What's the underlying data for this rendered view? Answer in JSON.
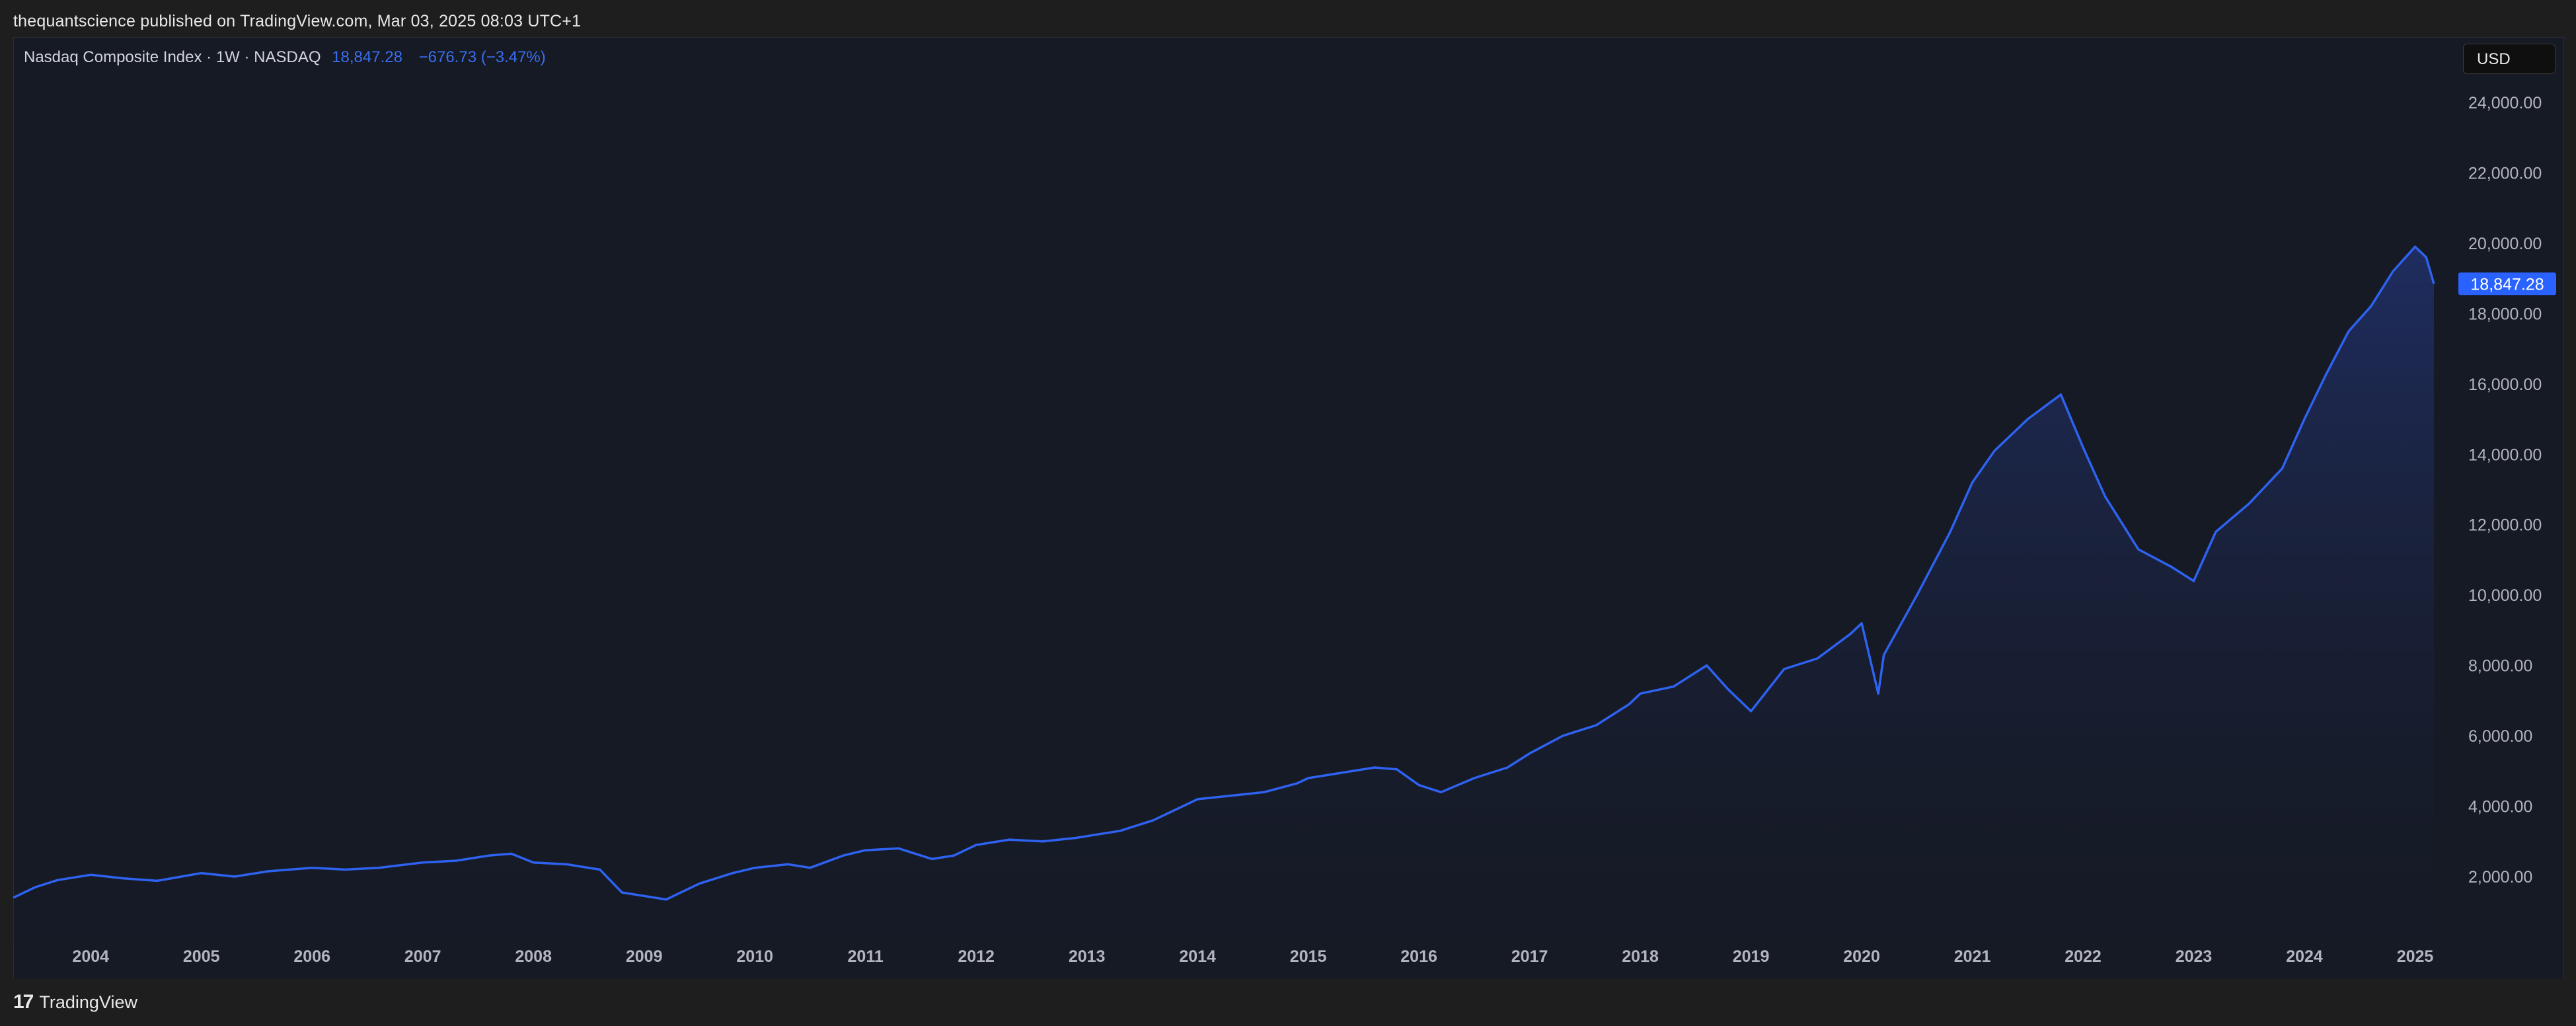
{
  "header": {
    "publish_line": "thequantscience published on TradingView.com, Mar 03, 2025 08:03 UTC+1"
  },
  "legend": {
    "symbol": "Nasdaq Composite Index · 1W · NASDAQ",
    "last_value": "18,847.28",
    "change": "−676.73 (−3.47%)"
  },
  "toolbar": {
    "currency_label": "USD"
  },
  "price_badge": {
    "label": "18,847.28"
  },
  "footer": {
    "logo_mark": "17",
    "brand": "TradingView"
  },
  "colors": {
    "line": "#2e62f0",
    "fill_top": "#1f2e63",
    "fill_bottom": "#161a25",
    "badge": "#2962ff",
    "axis_text": "#b2b5be",
    "background": "#161a25"
  },
  "chart_data": {
    "type": "area",
    "title": "",
    "xlabel": "",
    "ylabel": "",
    "x_ticks": [
      "2004",
      "2005",
      "2006",
      "2007",
      "2008",
      "2009",
      "2010",
      "2011",
      "2012",
      "2013",
      "2014",
      "2015",
      "2016",
      "2017",
      "2018",
      "2019",
      "2020",
      "2021",
      "2022",
      "2023",
      "2024",
      "2025"
    ],
    "y_ticks": [
      "2,000.00",
      "4,000.00",
      "6,000.00",
      "8,000.00",
      "10,000.00",
      "12,000.00",
      "14,000.00",
      "16,000.00",
      "18,000.00",
      "20,000.00",
      "22,000.00",
      "24,000.00"
    ],
    "y_tick_values": [
      2000,
      4000,
      6000,
      8000,
      10000,
      12000,
      14000,
      16000,
      18000,
      20000,
      22000,
      24000
    ],
    "xlim": [
      2003.3,
      2025.2
    ],
    "ylim": [
      0,
      25000
    ],
    "grid": false,
    "series": [
      {
        "x": [
          2003.3,
          2003.5,
          2003.7,
          2004.0,
          2004.3,
          2004.6,
          2005.0,
          2005.3,
          2005.6,
          2006.0,
          2006.3,
          2006.6,
          2007.0,
          2007.3,
          2007.6,
          2007.8,
          2008.0,
          2008.3,
          2008.6,
          2008.8,
          2009.0,
          2009.2,
          2009.5,
          2009.8,
          2010.0,
          2010.3,
          2010.5,
          2010.8,
          2011.0,
          2011.3,
          2011.6,
          2011.8,
          2012.0,
          2012.3,
          2012.6,
          2012.9,
          2013.0,
          2013.3,
          2013.6,
          2013.9,
          2014.0,
          2014.3,
          2014.6,
          2014.9,
          2015.0,
          2015.3,
          2015.6,
          2015.8,
          2016.0,
          2016.2,
          2016.5,
          2016.8,
          2017.0,
          2017.3,
          2017.6,
          2017.9,
          2018.0,
          2018.3,
          2018.6,
          2018.8,
          2019.0,
          2019.3,
          2019.6,
          2019.9,
          2020.0,
          2020.15,
          2020.2,
          2020.5,
          2020.8,
          2021.0,
          2021.2,
          2021.5,
          2021.8,
          2022.0,
          2022.2,
          2022.5,
          2022.8,
          2023.0,
          2023.2,
          2023.5,
          2023.8,
          2024.0,
          2024.2,
          2024.4,
          2024.6,
          2024.8,
          2025.0,
          2025.1,
          2025.17
        ],
        "values": [
          1400,
          1700,
          1900,
          2050,
          1950,
          1880,
          2100,
          2000,
          2150,
          2250,
          2200,
          2250,
          2400,
          2450,
          2600,
          2650,
          2400,
          2350,
          2200,
          1550,
          1450,
          1350,
          1800,
          2100,
          2250,
          2350,
          2250,
          2600,
          2750,
          2800,
          2500,
          2600,
          2900,
          3050,
          3000,
          3100,
          3150,
          3300,
          3600,
          4050,
          4200,
          4300,
          4400,
          4650,
          4800,
          4950,
          5100,
          5050,
          4600,
          4400,
          4800,
          5100,
          5500,
          6000,
          6300,
          6900,
          7200,
          7400,
          8000,
          7300,
          6700,
          7900,
          8200,
          8900,
          9200,
          7200,
          8300,
          10000,
          11800,
          13200,
          14100,
          15000,
          15700,
          14200,
          12800,
          11300,
          10800,
          10400,
          11800,
          12600,
          13600,
          15000,
          16300,
          17500,
          18200,
          19200,
          19900,
          19600,
          18847.28
        ]
      }
    ]
  }
}
